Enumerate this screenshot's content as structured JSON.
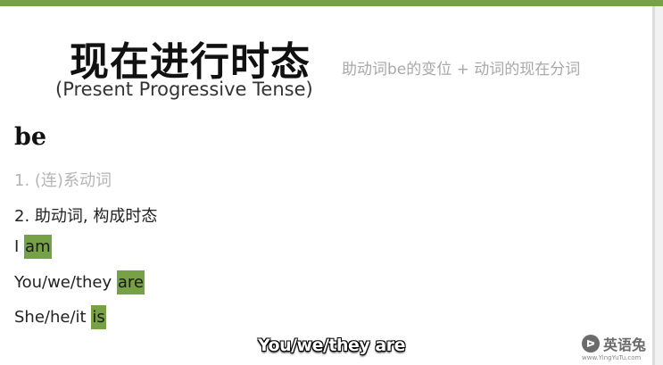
{
  "slide": {
    "title": "现在进行时态",
    "title_en": "(Present Progressive Tense)",
    "formula": "助动词be的变位 + 动词的现在分词",
    "heading": "be",
    "lines": [
      {
        "text": "1. (连)系动词"
      },
      {
        "text": "2. 助动词, 构成时态"
      }
    ],
    "examples": [
      {
        "subject": "I",
        "verb": "am"
      },
      {
        "subject": "You/we/they",
        "verb": "are"
      },
      {
        "subject": "She/he/it",
        "verb": "is"
      }
    ]
  },
  "caption": "You/we/they are",
  "watermark": {
    "name": "英语兔",
    "url": "www.YingYuTu.com",
    "icon": "rabbit-logo-icon"
  },
  "colors": {
    "accent": "#76a144",
    "muted_text": "#b5b5b5"
  }
}
